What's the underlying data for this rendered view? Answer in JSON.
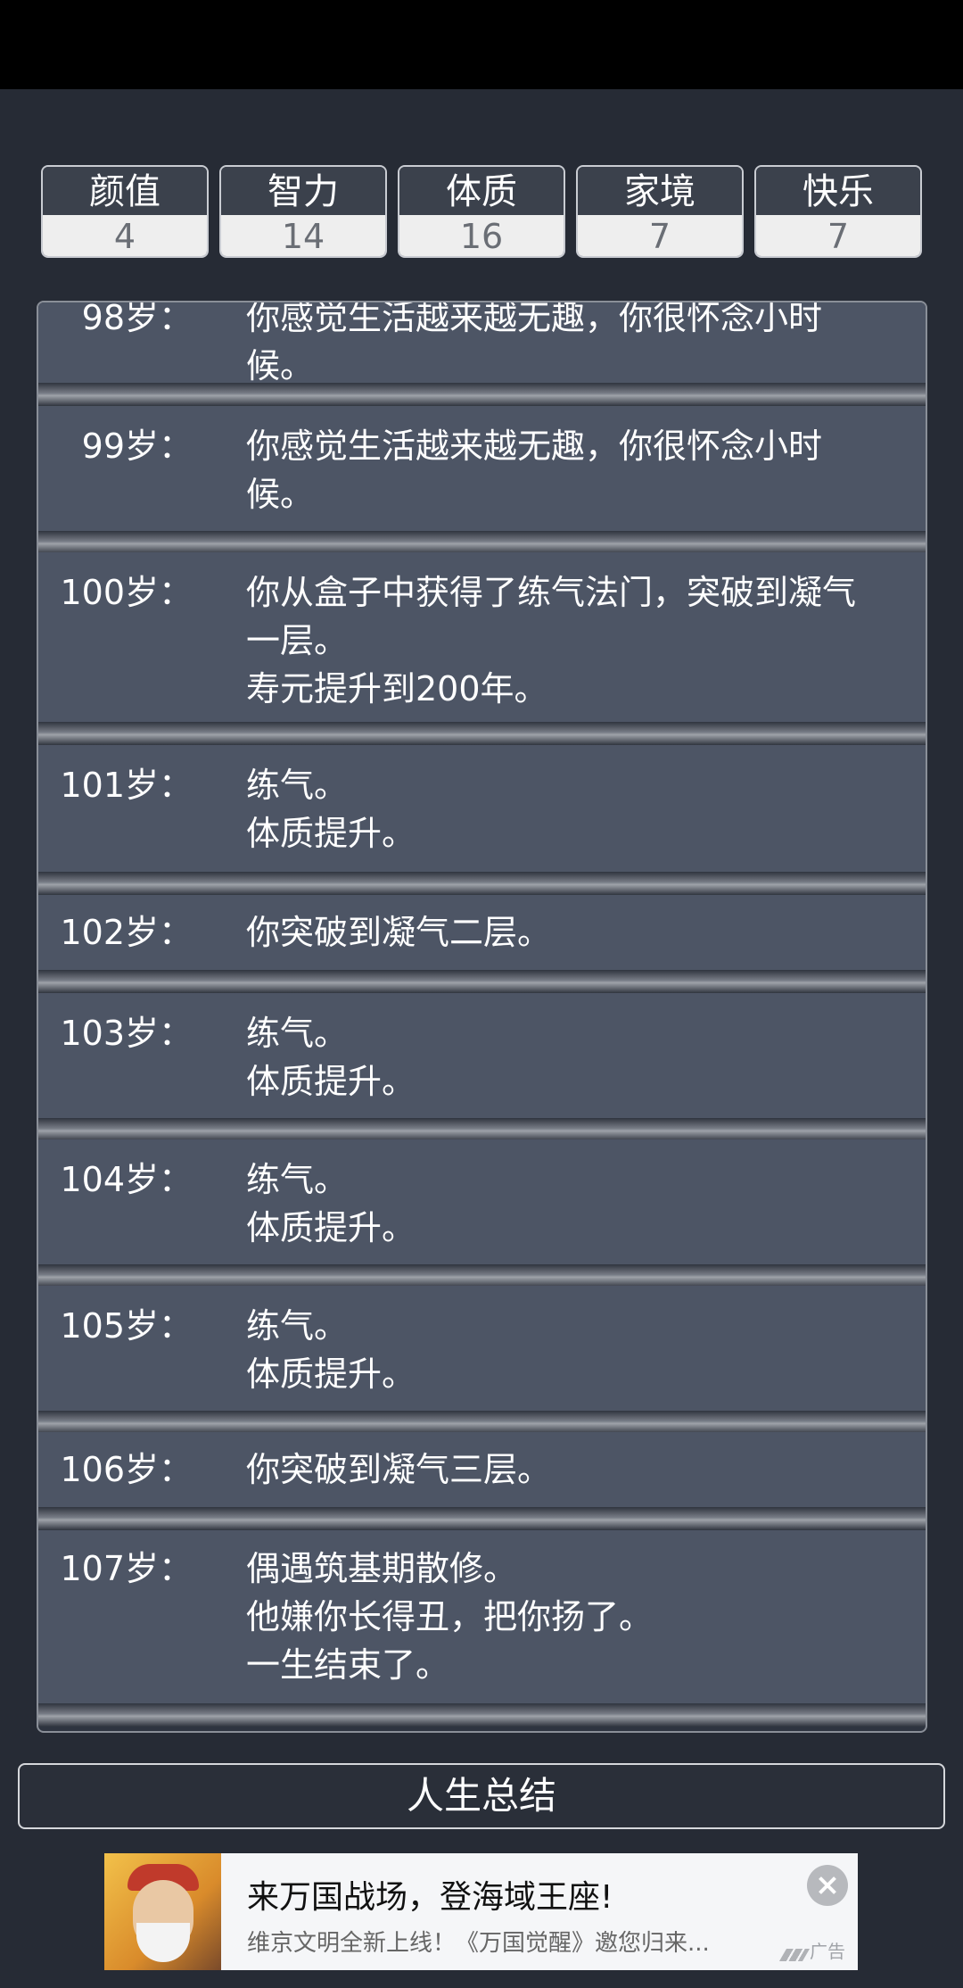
{
  "stats": [
    {
      "label": "颜值",
      "value": "4"
    },
    {
      "label": "智力",
      "value": "14"
    },
    {
      "label": "体质",
      "value": "16"
    },
    {
      "label": "家境",
      "value": "7"
    },
    {
      "label": "快乐",
      "value": "7"
    }
  ],
  "log": [
    {
      "age": "98岁：",
      "lines": [
        "你感觉生活越来越无趣，你很怀念小时",
        "候。"
      ]
    },
    {
      "age": "99岁：",
      "lines": [
        "你感觉生活越来越无趣，你很怀念小时",
        "候。"
      ]
    },
    {
      "age": "100岁：",
      "lines": [
        "你从盒子中获得了练气法门，突破到凝气",
        "一层。",
        "寿元提升到200年。"
      ]
    },
    {
      "age": "101岁：",
      "lines": [
        "练气。",
        "体质提升。"
      ]
    },
    {
      "age": "102岁：",
      "lines": [
        "你突破到凝气二层。"
      ]
    },
    {
      "age": "103岁：",
      "lines": [
        "练气。",
        "体质提升。"
      ]
    },
    {
      "age": "104岁：",
      "lines": [
        "练气。",
        "体质提升。"
      ]
    },
    {
      "age": "105岁：",
      "lines": [
        "练气。",
        "体质提升。"
      ]
    },
    {
      "age": "106岁：",
      "lines": [
        "你突破到凝气三层。"
      ]
    },
    {
      "age": "107岁：",
      "lines": [
        "偶遇筑基期散修。",
        "他嫌你长得丑，把你扬了。",
        "一生结束了。"
      ]
    }
  ],
  "summary_button": "人生总结",
  "ad": {
    "title": "来万国战场，登海域王座!",
    "description": "维京文明全新上线！《万国觉醒》邀您归来...",
    "label": "广告"
  }
}
